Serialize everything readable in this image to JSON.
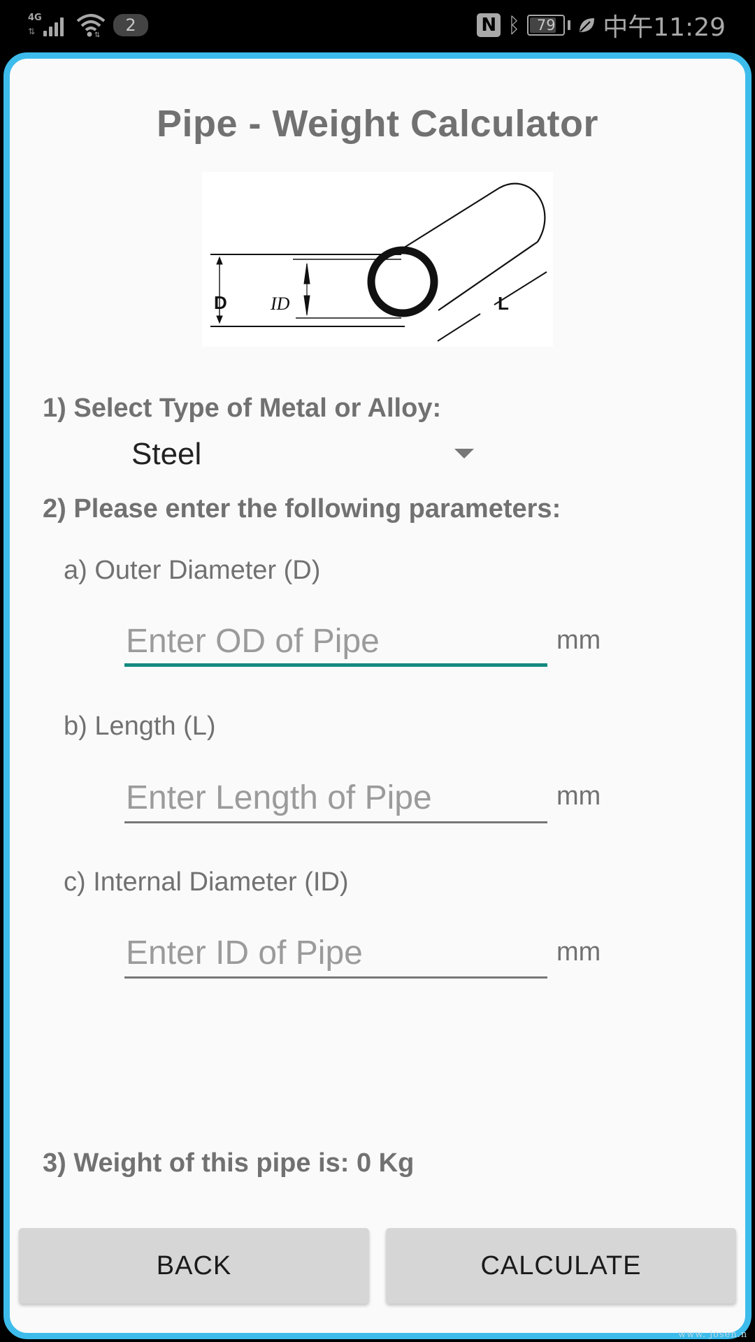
{
  "status_bar": {
    "network_type": "4G",
    "notification_count": "2",
    "battery_level": "79",
    "battery_fraction": 0.79,
    "time": "中午11:29",
    "icons": [
      "signal-4g-icon",
      "wifi-icon",
      "nfc-icon",
      "bluetooth-icon",
      "battery-icon",
      "power-saving-leaf-icon"
    ]
  },
  "app": {
    "title": "Pipe - Weight Calculator",
    "diagram": {
      "labels": {
        "outer_diameter": "D",
        "inner_diameter": "ID",
        "length": "L"
      }
    },
    "step1": {
      "heading": "1) Select Type of Metal or Alloy:",
      "selected_metal": "Steel"
    },
    "step2": {
      "heading": "2) Please enter the following parameters:",
      "fields": [
        {
          "label": "a) Outer Diameter (D)",
          "placeholder": "Enter OD of Pipe",
          "value": "",
          "unit": "mm",
          "focused": true
        },
        {
          "label": "b) Length (L)",
          "placeholder": "Enter Length of Pipe",
          "value": "",
          "unit": "mm",
          "focused": false
        },
        {
          "label": "c) Internal Diameter (ID)",
          "placeholder": "Enter ID of Pipe",
          "value": "",
          "unit": "mm",
          "focused": false
        }
      ]
    },
    "step3": {
      "result_text": "3) Weight of this pipe is: 0 Kg"
    },
    "buttons": {
      "back": "BACK",
      "calculate": "CALCULATE"
    },
    "colors": {
      "frame_border": "#3dbcec",
      "focus_underline": "#148a7f",
      "heading_text": "#717171",
      "button_bg": "#d6d6d6"
    }
  },
  "watermark": "www. josen.n"
}
